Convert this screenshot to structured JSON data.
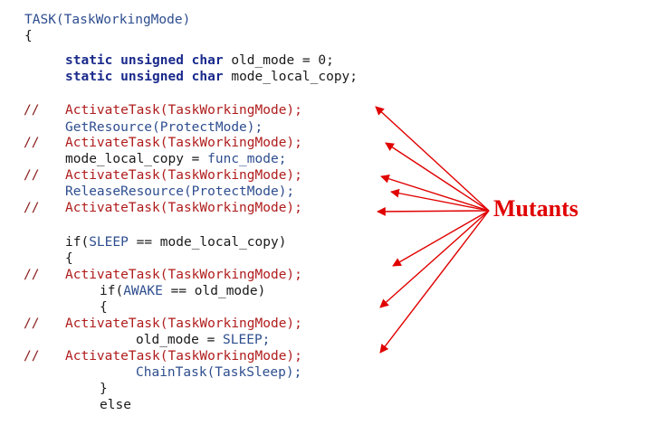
{
  "code_lines": [
    {
      "comment": "",
      "parts": [
        {
          "text": "TASK(TaskWorkingMode)",
          "style": "blue"
        }
      ]
    },
    {
      "comment": "",
      "parts": [
        {
          "text": "{",
          "style": "dark"
        }
      ]
    },
    {
      "comment": "",
      "parts": [
        {
          "text": "static unsigned char",
          "style": "kw"
        },
        {
          "text": " old_mode = 0;",
          "style": "dark"
        }
      ]
    },
    {
      "comment": "",
      "parts": [
        {
          "text": "static unsigned char",
          "style": "kw"
        },
        {
          "text": " mode_local_copy;",
          "style": "dark"
        }
      ]
    },
    {
      "comment": "//",
      "mutant": true,
      "parts": [
        {
          "text": "ActivateTask(TaskWorkingMode);",
          "style": "red"
        }
      ]
    },
    {
      "comment": "",
      "parts": [
        {
          "text": "GetResource(ProtectMode);",
          "style": "blue"
        }
      ]
    },
    {
      "comment": "//",
      "mutant": true,
      "parts": [
        {
          "text": "ActivateTask(TaskWorkingMode);",
          "style": "red"
        }
      ]
    },
    {
      "comment": "",
      "parts": [
        {
          "text": "mode_local_copy = ",
          "style": "dark"
        },
        {
          "text": "func_mode;",
          "style": "blue"
        }
      ]
    },
    {
      "comment": "//",
      "mutant": true,
      "parts": [
        {
          "text": "ActivateTask(TaskWorkingMode);",
          "style": "red"
        }
      ]
    },
    {
      "comment": "",
      "parts": [
        {
          "text": "ReleaseResource(ProtectMode);",
          "style": "blue"
        }
      ]
    },
    {
      "comment": "//",
      "mutant": true,
      "parts": [
        {
          "text": "ActivateTask(TaskWorkingMode);",
          "style": "red"
        }
      ]
    },
    {
      "comment": "",
      "parts": [
        {
          "text": "if(",
          "style": "dark"
        },
        {
          "text": "SLEEP",
          "style": "blue"
        },
        {
          "text": " == mode_local_copy)",
          "style": "dark"
        }
      ]
    },
    {
      "comment": "",
      "parts": [
        {
          "text": "{",
          "style": "dark"
        }
      ]
    },
    {
      "comment": "//",
      "mutant": true,
      "parts": [
        {
          "text": "ActivateTask(TaskWorkingMode);",
          "style": "red"
        }
      ]
    },
    {
      "comment": "",
      "parts": [
        {
          "text": "if(",
          "style": "dark"
        },
        {
          "text": "AWAKE",
          "style": "blue"
        },
        {
          "text": " == old_mode)",
          "style": "dark"
        }
      ]
    },
    {
      "comment": "",
      "parts": [
        {
          "text": "{",
          "style": "dark"
        }
      ]
    },
    {
      "comment": "//",
      "mutant": true,
      "parts": [
        {
          "text": "ActivateTask(TaskWorkingMode);",
          "style": "red"
        }
      ]
    },
    {
      "comment": "",
      "parts": [
        {
          "text": "old_mode = ",
          "style": "dark"
        },
        {
          "text": "SLEEP;",
          "style": "blue"
        }
      ]
    },
    {
      "comment": "//",
      "mutant": true,
      "parts": [
        {
          "text": "ActivateTask(TaskWorkingMode);",
          "style": "red"
        }
      ]
    },
    {
      "comment": "",
      "parts": [
        {
          "text": "ChainTask(TaskSleep);",
          "style": "blue"
        }
      ]
    },
    {
      "comment": "",
      "parts": [
        {
          "text": "}",
          "style": "dark"
        }
      ]
    },
    {
      "comment": "",
      "parts": [
        {
          "text": "else",
          "style": "dark"
        }
      ]
    }
  ],
  "annotation": {
    "label": "Mutants",
    "color": "#e00000"
  }
}
